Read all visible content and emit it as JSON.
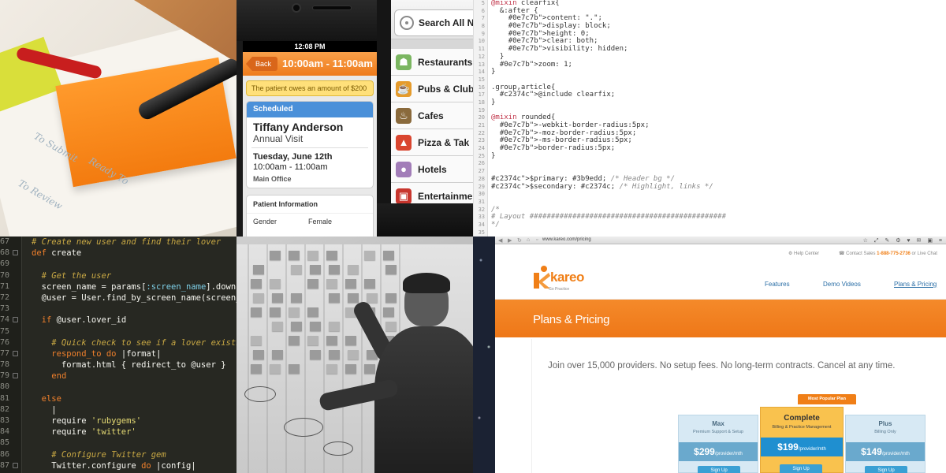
{
  "colors": {
    "scss_selector": "#555555",
    "scss_property": "#0e7c7b",
    "scss_value": "#2b52c6",
    "scss_keyword": "#c2374c",
    "scss_comment": "#888888",
    "ruby_comment": "#c8a844",
    "ruby_keyword": "#f0802c",
    "ruby_symbol": "#7fd0e8",
    "kareo_orange": "#f07f17",
    "kareo_blue": "#2a6ea6"
  },
  "phone": {
    "status_time": "12:08 PM",
    "back_label": "Back",
    "nav_title": "10:00am - 11:00am",
    "alert_text": "The patient owes an amount of $200",
    "status_header": "Scheduled",
    "patient_name": "Tiffany Anderson",
    "visit_type": "Annual Visit",
    "date": "Tuesday, June 12th",
    "time": "10:00am - 11:00am",
    "location": "Main Office",
    "patient_info_header": "Patient Information",
    "gender_label": "Gender",
    "gender_value": "Female"
  },
  "places": {
    "search_label": "Search All N",
    "items": [
      {
        "label": "Restaurants",
        "icon": "restaurant-icon",
        "color": "#7bb661"
      },
      {
        "label": "Pubs & Club",
        "icon": "beer-icon",
        "color": "#e59b2c"
      },
      {
        "label": "Cafes",
        "icon": "coffee-icon",
        "color": "#8a6a3c"
      },
      {
        "label": "Pizza & Tak",
        "icon": "pizza-icon",
        "color": "#d9452f"
      },
      {
        "label": "Hotels",
        "icon": "hotel-bell-icon",
        "color": "#a27db8"
      },
      {
        "label": "Entertainmen",
        "icon": "theater-icon",
        "color": "#c8362e"
      }
    ]
  },
  "scss": {
    "lines": [
      {
        "n": "5",
        "t": "@mixin clearfix{"
      },
      {
        "n": "6",
        "t": "  &:after {"
      },
      {
        "n": "7",
        "t": "    content: \".\";"
      },
      {
        "n": "8",
        "t": "    display: block;"
      },
      {
        "n": "9",
        "t": "    height: 0;"
      },
      {
        "n": "10",
        "t": "    clear: both;"
      },
      {
        "n": "11",
        "t": "    visibility: hidden;"
      },
      {
        "n": "12",
        "t": "  }"
      },
      {
        "n": "13",
        "t": "  zoom: 1;"
      },
      {
        "n": "14",
        "t": "}"
      },
      {
        "n": "15",
        "t": ""
      },
      {
        "n": "16",
        "t": ".group,article{"
      },
      {
        "n": "17",
        "t": "  @include clearfix;"
      },
      {
        "n": "18",
        "t": "}"
      },
      {
        "n": "19",
        "t": ""
      },
      {
        "n": "20",
        "t": "@mixin rounded{"
      },
      {
        "n": "21",
        "t": "  -webkit-border-radius:5px;"
      },
      {
        "n": "22",
        "t": "  -moz-border-radius:5px;"
      },
      {
        "n": "23",
        "t": "  -ms-border-radius:5px;"
      },
      {
        "n": "24",
        "t": "  border-radius:5px;"
      },
      {
        "n": "25",
        "t": "}"
      },
      {
        "n": "26",
        "t": ""
      },
      {
        "n": "27",
        "t": ""
      },
      {
        "n": "28",
        "t": "$primary: #3b9edd; /* Header bg */"
      },
      {
        "n": "29",
        "t": "$secondary: #c2374c; /* Highlight, links */"
      },
      {
        "n": "30",
        "t": ""
      },
      {
        "n": "31",
        "t": ""
      },
      {
        "n": "32",
        "t": "/*"
      },
      {
        "n": "33",
        "t": "# Layout ##############################################"
      },
      {
        "n": "34",
        "t": "*/"
      },
      {
        "n": "35",
        "t": ""
      }
    ]
  },
  "ruby": {
    "lines": [
      {
        "n": "67",
        "t": "# Create new user and find their lover",
        "k": "comment",
        "fold": false
      },
      {
        "n": "68",
        "t": "def create",
        "k": "keyword",
        "fold": true
      },
      {
        "n": "69",
        "t": "",
        "k": "plain",
        "fold": false
      },
      {
        "n": "70",
        "t": "  # Get the user",
        "k": "comment",
        "fold": false
      },
      {
        "n": "71",
        "t": "  screen_name = params[:screen_name].downca",
        "k": "plain",
        "fold": false
      },
      {
        "n": "72",
        "t": "  @user = User.find_by_screen_name(screen_n",
        "k": "plain",
        "fold": false
      },
      {
        "n": "73",
        "t": "",
        "k": "plain",
        "fold": false
      },
      {
        "n": "74",
        "t": "  if @user.lover_id",
        "k": "keyword",
        "fold": true
      },
      {
        "n": "75",
        "t": "",
        "k": "plain",
        "fold": false
      },
      {
        "n": "76",
        "t": "    # Quick check to see if a lover exists.",
        "k": "comment",
        "fold": false
      },
      {
        "n": "77",
        "t": "    respond_to do |format|",
        "k": "keyword",
        "fold": true
      },
      {
        "n": "78",
        "t": "      format.html { redirect_to @user }",
        "k": "plain",
        "fold": false
      },
      {
        "n": "79",
        "t": "    end",
        "k": "keyword",
        "fold": true
      },
      {
        "n": "80",
        "t": "",
        "k": "plain",
        "fold": false
      },
      {
        "n": "81",
        "t": "  else",
        "k": "keyword",
        "fold": false
      },
      {
        "n": "82",
        "t": "    |",
        "k": "plain",
        "fold": false
      },
      {
        "n": "83",
        "t": "    require 'rubygems'",
        "k": "plain",
        "fold": false
      },
      {
        "n": "84",
        "t": "    require 'twitter'",
        "k": "plain",
        "fold": false
      },
      {
        "n": "85",
        "t": "",
        "k": "plain",
        "fold": false
      },
      {
        "n": "86",
        "t": "    # Configure Twitter gem",
        "k": "comment",
        "fold": false
      },
      {
        "n": "87",
        "t": "    Twitter.configure do |config|",
        "k": "plain",
        "fold": true
      }
    ]
  },
  "kareo": {
    "url": "www.kareo.com/pricing",
    "help_center": "Help Center",
    "contact_prefix": "Contact Sales",
    "contact_phone": "1-888-775-2736",
    "contact_suffix": "or Live Chat",
    "logo_word": "kareo",
    "logo_tag": "Go Practice",
    "nav": [
      {
        "label": "Features",
        "active": false
      },
      {
        "label": "Demo Videos",
        "active": false
      },
      {
        "label": "Plans & Pricing",
        "active": true
      }
    ],
    "banner_title": "Plans & Pricing",
    "tagline": "Join over 15,000 providers. No setup fees. No long-term contracts. Cancel at any time.",
    "popular_label": "Most Popular Plan",
    "plans": [
      {
        "name": "Max",
        "desc": "Premium Support & Setup",
        "price": "$299",
        "unit": "/provider/mth",
        "button": "Sign Up",
        "featured": false
      },
      {
        "name": "Complete",
        "desc": "Billing & Practice Management",
        "price": "$199",
        "unit": "/provider/mth",
        "button": "Sign Up",
        "featured": true
      },
      {
        "name": "Plus",
        "desc": "Billing Only",
        "price": "$149",
        "unit": "/provider/mth",
        "button": "Sign Up",
        "featured": false
      }
    ]
  },
  "board": {
    "notes": 60
  },
  "notes_scrawl": [
    "To Submit",
    "Ready To",
    "To Review"
  ]
}
